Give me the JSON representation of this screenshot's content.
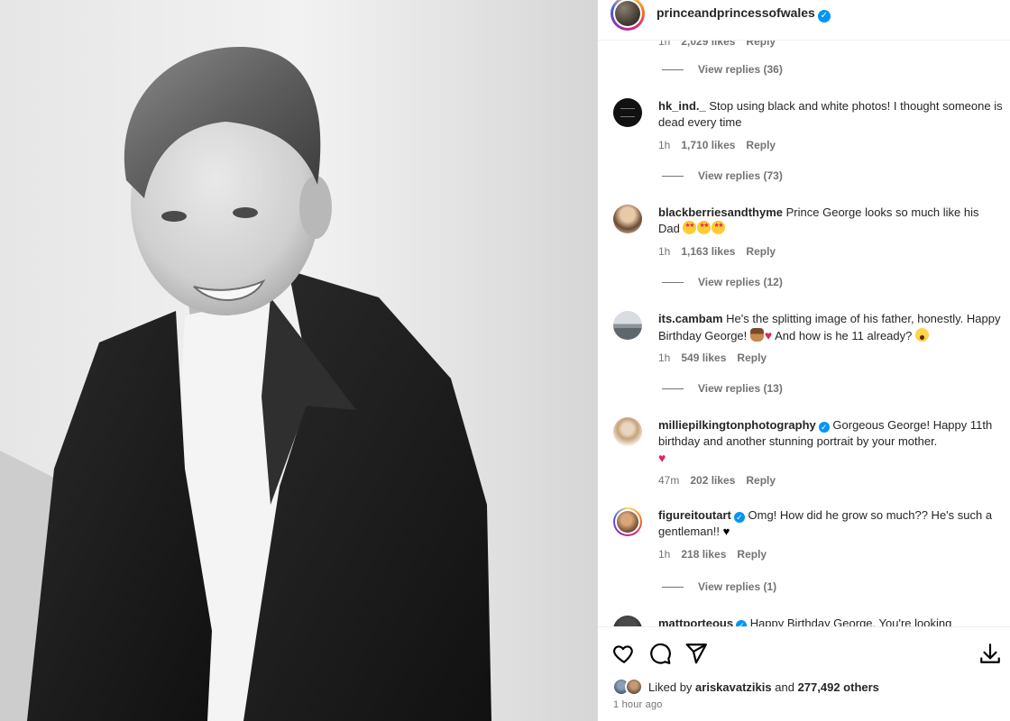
{
  "post": {
    "username": "princeandprincessofwales",
    "verified_icon": "verified-badge-icon"
  },
  "partial_comment": {
    "time": "1h",
    "likes": "2,029 likes",
    "reply": "Reply",
    "view_replies": "View replies (36)"
  },
  "comments": [
    {
      "username": "hk_ind._",
      "verified": false,
      "text_1": "Stop using black and white photos! I thought someone is dead every time",
      "time": "1h",
      "likes": "1,710 likes",
      "reply": "Reply",
      "view_replies": "View replies (73)"
    },
    {
      "username": "blackberriesandthyme",
      "verified": false,
      "text_1": "Prince George looks so much like his Dad",
      "emojis": [
        "star-struck-emoji",
        "star-struck-emoji",
        "star-struck-emoji"
      ],
      "time": "1h",
      "likes": "1,163 likes",
      "reply": "Reply",
      "view_replies": "View replies (12)"
    },
    {
      "username": "its.cambam",
      "verified": false,
      "text_1": "He's the splitting image of his father, honestly. Happy Birthday George!",
      "text_2": "And how is he 11 already?",
      "emojis": [
        "birthday-cake-emoji",
        "red-heart-emoji",
        "screaming-face-emoji"
      ],
      "time": "1h",
      "likes": "549 likes",
      "reply": "Reply",
      "view_replies": "View replies (13)"
    },
    {
      "username": "milliepilkingtonphotography",
      "verified": true,
      "text_1": "Gorgeous George! Happy 11th birthday and another stunning portrait by your mother.",
      "emojis": [
        "red-heart-emoji"
      ],
      "time": "47m",
      "likes": "202 likes",
      "reply": "Reply"
    },
    {
      "username": "figureitoutart",
      "verified": true,
      "text_1": "Omg! How did he grow so much?? He's such a gentleman!!",
      "emojis": [
        "black-heart-emoji"
      ],
      "time": "1h",
      "likes": "218 likes",
      "reply": "Reply",
      "view_replies": "View replies (1)"
    },
    {
      "username": "mattporteous",
      "verified": true,
      "text_1": "Happy Birthday George. You're looking"
    }
  ],
  "actions": {
    "like_icon": "heart-icon",
    "comment_icon": "comment-icon",
    "share_icon": "share-icon",
    "save_icon": "save-icon"
  },
  "likes": {
    "prefix": "Liked by",
    "user": "ariskavatzikis",
    "middle": "and",
    "others": "277,492 others"
  },
  "timestamp": "1 hour ago",
  "colors": {
    "verified": "#0095f6",
    "secondary_text": "#737373",
    "primary_text": "#262626",
    "heart_red": "#e0245e"
  }
}
